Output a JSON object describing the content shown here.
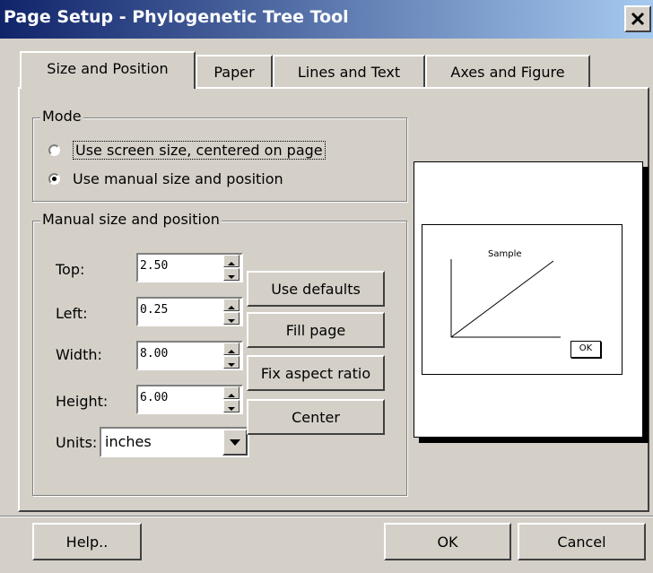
{
  "window": {
    "title": "Page Setup - Phylogenetic Tree Tool"
  },
  "tabs": [
    {
      "label": "Size and Position",
      "active": true
    },
    {
      "label": "Paper"
    },
    {
      "label": "Lines and Text"
    },
    {
      "label": "Axes and Figure"
    }
  ],
  "mode": {
    "legend": "Mode",
    "options": [
      {
        "label": "Use screen size, centered on page",
        "selected": false
      },
      {
        "label": "Use manual size and position",
        "selected": true
      }
    ]
  },
  "manual": {
    "legend": "Manual size and position",
    "fields": [
      {
        "label": "Top:",
        "value": "2.50"
      },
      {
        "label": "Left:",
        "value": "0.25"
      },
      {
        "label": "Width:",
        "value": "8.00"
      },
      {
        "label": "Height:",
        "value": "6.00"
      }
    ],
    "units_label": "Units:",
    "units_value": "inches",
    "buttons": {
      "use_defaults": "Use defaults",
      "fill_page": "Fill page",
      "fix_aspect": "Fix aspect ratio",
      "center": "Center"
    }
  },
  "preview": {
    "sample_label": "Sample",
    "ok_label": "OK"
  },
  "footer": {
    "help": "Help..",
    "ok": "OK",
    "cancel": "Cancel"
  }
}
